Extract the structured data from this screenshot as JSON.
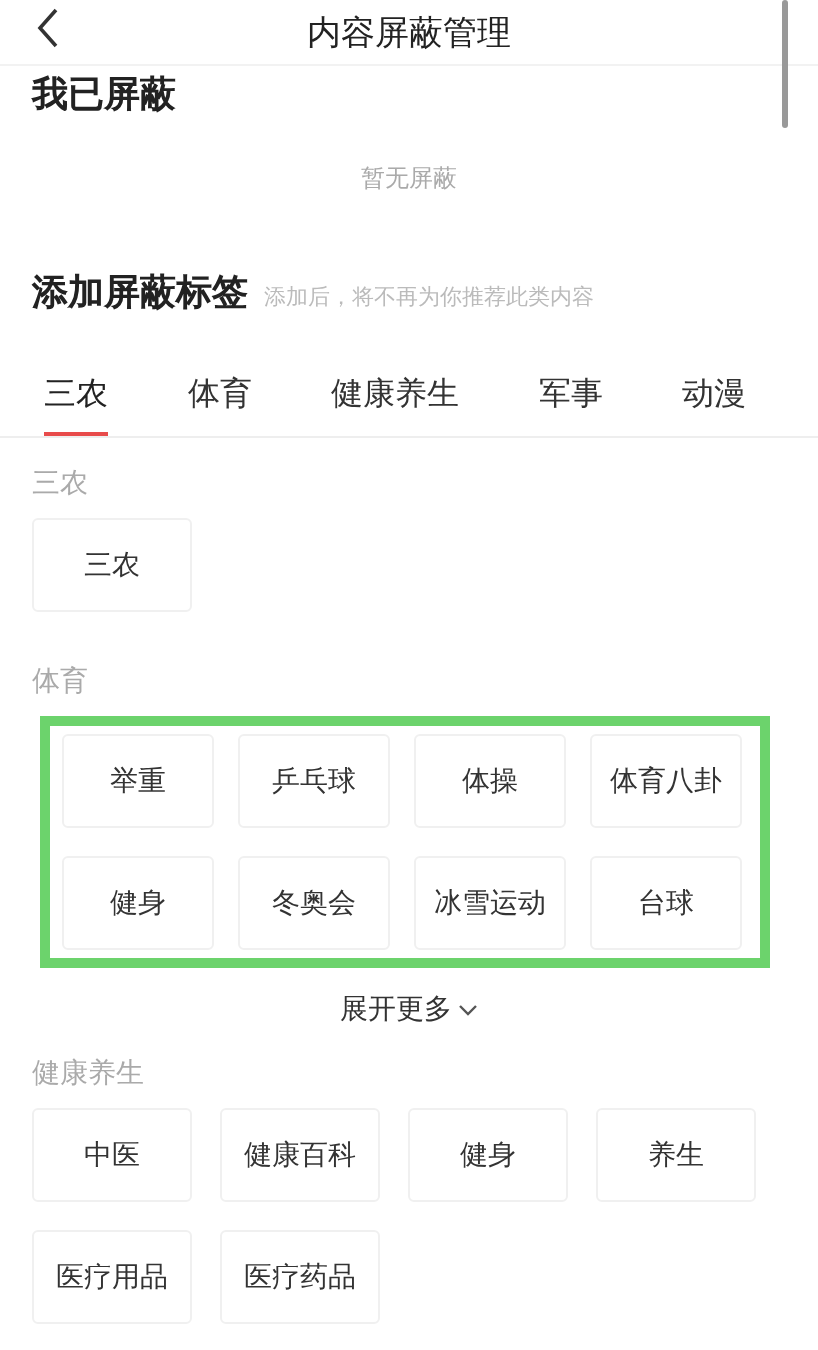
{
  "header": {
    "title": "内容屏蔽管理"
  },
  "blocked": {
    "title": "我已屏蔽",
    "empty_text": "暂无屏蔽"
  },
  "add": {
    "title": "添加屏蔽标签",
    "hint": "添加后，将不再为你推荐此类内容"
  },
  "tabs": [
    {
      "label": "三农",
      "selected": true
    },
    {
      "label": "体育",
      "selected": false
    },
    {
      "label": "健康养生",
      "selected": false
    },
    {
      "label": "军事",
      "selected": false
    },
    {
      "label": "动漫",
      "selected": false
    }
  ],
  "groups": [
    {
      "label": "三农",
      "highlighted": false,
      "tags": [
        "三农"
      ]
    },
    {
      "label": "体育",
      "highlighted": true,
      "tags": [
        "举重",
        "乒乓球",
        "体操",
        "体育八卦",
        "健身",
        "冬奥会",
        "冰雪运动",
        "台球"
      ],
      "more": "展开更多"
    },
    {
      "label": "健康养生",
      "highlighted": false,
      "tags": [
        "中医",
        "健康百科",
        "健身",
        "养生",
        "医疗用品",
        "医疗药品"
      ]
    }
  ]
}
